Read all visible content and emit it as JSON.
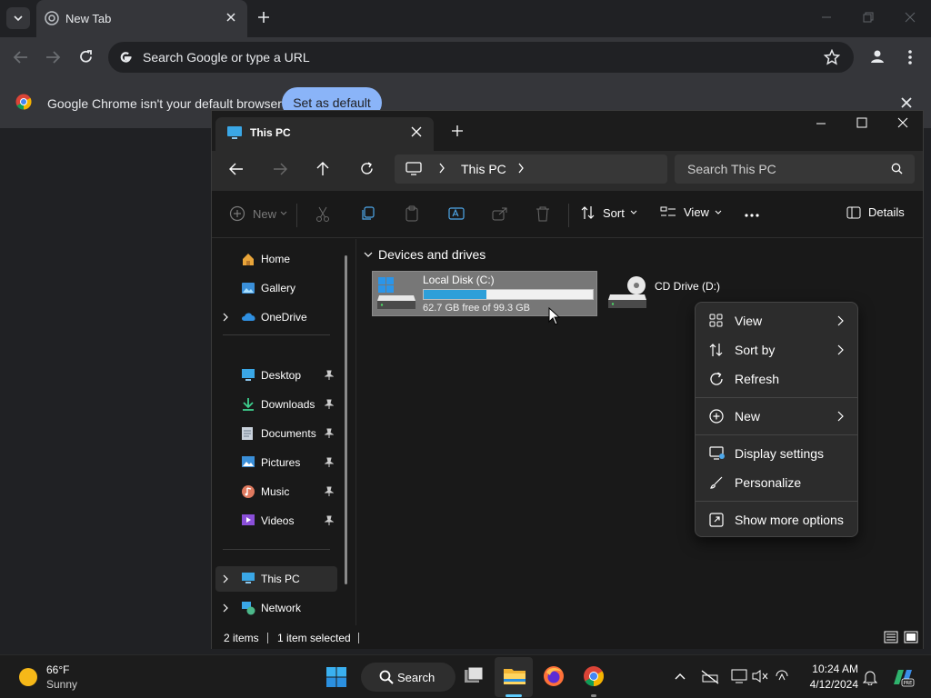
{
  "chrome": {
    "tab_title": "New Tab",
    "omnibox_placeholder": "Search Google or type a URL",
    "infobar_message": "Google Chrome isn't your default browser",
    "set_default_label": "Set as default"
  },
  "explorer": {
    "tab_title": "This PC",
    "breadcrumb_location": "This PC",
    "search_placeholder": "Search This PC",
    "toolbar": {
      "new_label": "New",
      "sort_label": "Sort",
      "view_label": "View",
      "details_label": "Details"
    },
    "nav": {
      "top": [
        {
          "label": "Home",
          "icon": "home-icon"
        },
        {
          "label": "Gallery",
          "icon": "gallery-icon"
        },
        {
          "label": "OneDrive",
          "icon": "onedrive-icon"
        }
      ],
      "pinned": [
        {
          "label": "Desktop",
          "icon": "desktop-icon"
        },
        {
          "label": "Downloads",
          "icon": "downloads-icon"
        },
        {
          "label": "Documents",
          "icon": "documents-icon"
        },
        {
          "label": "Pictures",
          "icon": "pictures-icon"
        },
        {
          "label": "Music",
          "icon": "music-icon"
        },
        {
          "label": "Videos",
          "icon": "videos-icon"
        }
      ],
      "bottom": [
        {
          "label": "This PC",
          "icon": "this-pc-icon"
        },
        {
          "label": "Network",
          "icon": "network-icon"
        }
      ]
    },
    "group_header": "Devices and drives",
    "drives": [
      {
        "name": "Local Disk (C:)",
        "free_text": "62.7 GB free of 99.3 GB",
        "used_fraction": 0.369
      },
      {
        "name": "CD Drive (D:)"
      }
    ],
    "status": {
      "item_count": "2 items",
      "selection": "1 item selected"
    }
  },
  "context_menu": {
    "items": [
      {
        "label": "View",
        "icon": "grid-icon",
        "submenu": true
      },
      {
        "label": "Sort by",
        "icon": "sort-icon",
        "submenu": true
      },
      {
        "label": "Refresh",
        "icon": "refresh-icon",
        "submenu": false
      },
      {
        "label": "New",
        "icon": "plus-circle-icon",
        "submenu": true
      },
      {
        "label": "Display settings",
        "icon": "display-icon",
        "submenu": false
      },
      {
        "label": "Personalize",
        "icon": "brush-icon",
        "submenu": false
      },
      {
        "label": "Show more options",
        "icon": "more-options-icon",
        "submenu": false
      }
    ]
  },
  "taskbar": {
    "weather_temp": "66°F",
    "weather_condition": "Sunny",
    "search_label": "Search",
    "time": "10:24 AM",
    "date": "4/12/2024"
  },
  "colors": {
    "accent": "#8ab4f8",
    "drive_fill": "#2d9fd9"
  }
}
